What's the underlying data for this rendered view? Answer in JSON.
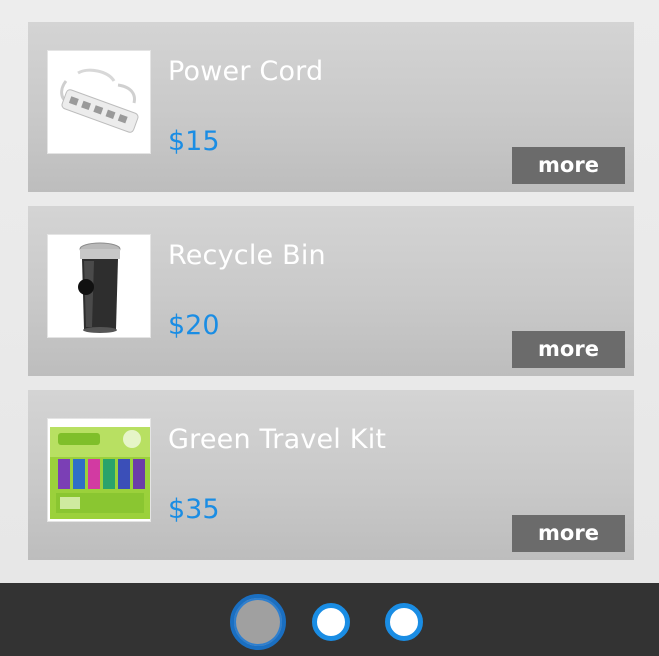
{
  "products": [
    {
      "title": "Power Cord",
      "price": "$15",
      "more_label": "more",
      "image": "power-strip"
    },
    {
      "title": "Recycle Bin",
      "price": "$20",
      "more_label": "more",
      "image": "trash-can"
    },
    {
      "title": "Green Travel Kit",
      "price": "$35",
      "more_label": "more",
      "image": "travel-kit-box"
    }
  ],
  "pager": {
    "pages": 3,
    "current": 1
  },
  "colors": {
    "price": "#1a8de4",
    "more_button": "#6b6b6b",
    "pager_bar": "#333333",
    "dot_border": "#1a8de4"
  }
}
